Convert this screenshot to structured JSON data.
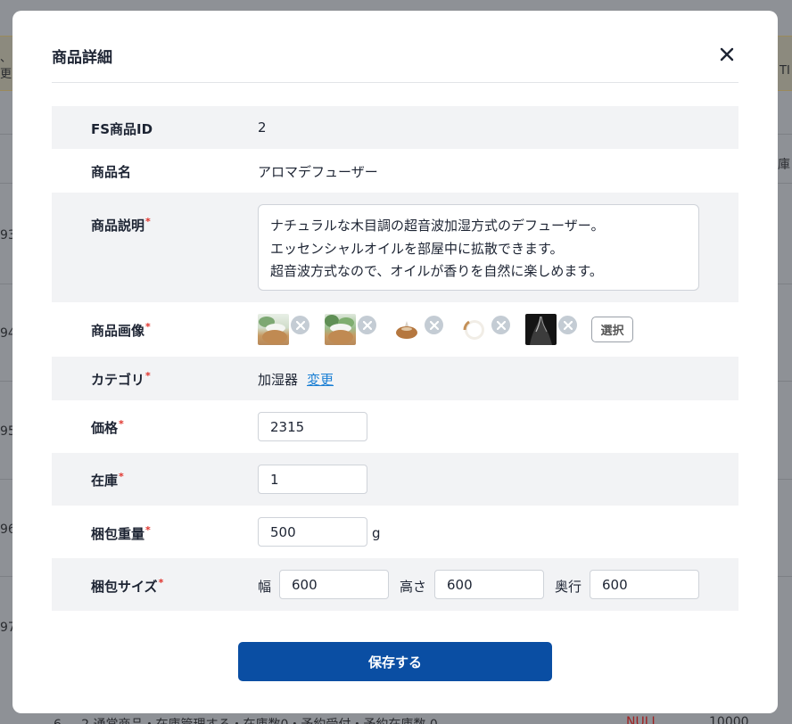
{
  "modal": {
    "title": "商品詳細",
    "save_label": "保存する"
  },
  "fields": {
    "fs_id": {
      "label": "FS商品ID",
      "value": "2"
    },
    "name": {
      "label": "商品名",
      "value": "アロマデフューザー"
    },
    "description": {
      "label": "商品説明",
      "required": "*",
      "value": "ナチュラルな木目調の超音波加湿方式のデフューザー。\nエッセンシャルオイルを部屋中に拡散できます。\n超音波方式なので、オイルが香りを自然に楽しめます。"
    },
    "images": {
      "label": "商品画像",
      "required": "*",
      "select_label": "選択"
    },
    "category": {
      "label": "カテゴリ",
      "required": "*",
      "value": "加湿器",
      "change_label": "変更"
    },
    "price": {
      "label": "価格",
      "required": "*",
      "value": "2315"
    },
    "stock": {
      "label": "在庫",
      "required": "*",
      "value": "1"
    },
    "package_weight": {
      "label": "梱包重量",
      "required": "*",
      "value": "500",
      "unit": "g"
    },
    "package_size": {
      "label": "梱包サイズ",
      "required": "*",
      "width_label": "幅",
      "width": "600",
      "height_label": "高さ",
      "height": "600",
      "depth_label": "奥行",
      "depth": "600"
    }
  },
  "background": {
    "left_fragments": [
      "、",
      "更",
      "93",
      "94",
      "95",
      "96",
      "97"
    ],
    "right_fragments": [
      "T",
      "庫",
      "TI"
    ],
    "bottom_text": "6     2 通常商品・在庫管理する・在庫数0・予約受付・予約在庫数 0",
    "bottom_null": "NULL",
    "bottom_number": "10000"
  },
  "colors": {
    "primary": "#0a4ea3",
    "required": "#e0322b",
    "link": "#1a7fd4",
    "row_shade": "#f2f3f5"
  }
}
